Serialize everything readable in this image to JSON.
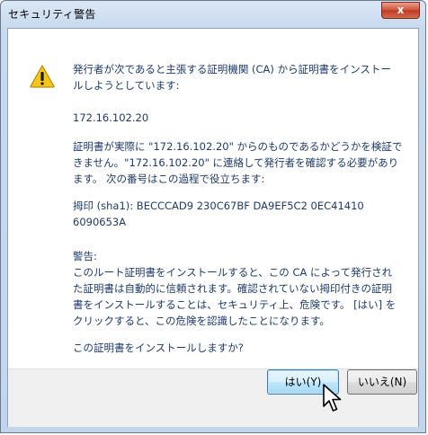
{
  "window": {
    "title": "セキュリティ警告",
    "close_glyph": "x"
  },
  "dialog": {
    "icon": "warning-icon",
    "paragraphs": [
      "発行者が次であると主張する証明機関 (CA) から証明書をインストー\nルしようとしています:",
      "172.16.102.20",
      "証明書が実際に \"172.16.102.20\" からのものであるかどうかを検証で\nきません。\"172.16.102.20\" に連絡して発行者を確認する必要があり\nます。 次の番号はこの過程で役立ちます:",
      "拇印 (sha1): BECCCAD9 230C67BF DA9EF5C2 0EC41410\n6090653A",
      "警告:\nこのルート証明書をインストールすると、この CA によって発行され\nた証明書は自動的に信頼されます。確認されていない拇印付きの証明\n書をインストールすることは、セキュリティ上、危険です。 [はい] を\nクリックすると、この危険を認識したことになります。",
      "この証明書をインストールしますか?"
    ]
  },
  "buttons": {
    "yes_label": "はい(Y)",
    "no_label": "いいえ(N)"
  },
  "colors": {
    "text": "#1e3b6a",
    "title_gradient_top": "#dbe7f5",
    "close_red": "#c03a22",
    "warning_yellow": "#f5c518"
  }
}
